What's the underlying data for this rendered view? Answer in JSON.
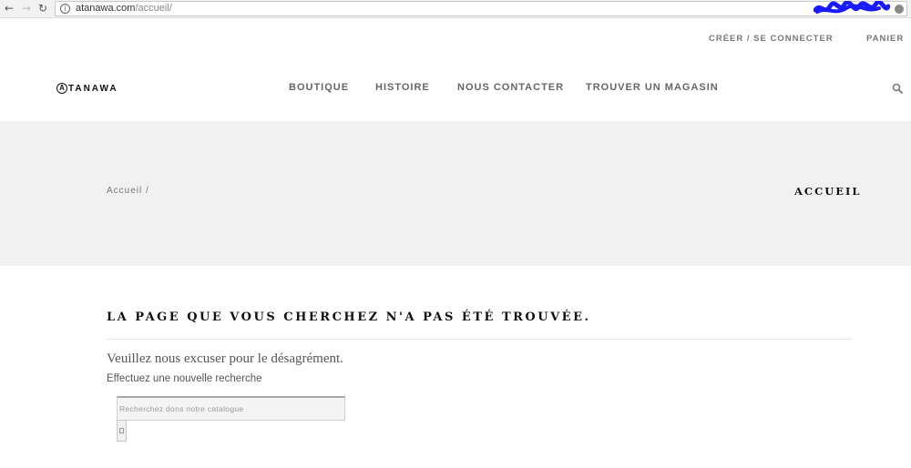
{
  "browser": {
    "url_host": "atanawa.com",
    "url_path": "/accueil/"
  },
  "top_links": {
    "login": "CRÉER / SE CONNECTER",
    "cart": "PANIER"
  },
  "logo": {
    "mark": "A",
    "text": "TANAWA"
  },
  "nav": {
    "items": [
      "BOUTIQUE",
      "HISTOIRE",
      "NOUS CONTACTER",
      "TROUVER UN MAGASIN"
    ]
  },
  "breadcrumb": {
    "home": "Accueil",
    "separator": " /"
  },
  "page_heading": "ACCUEIL",
  "error": {
    "title": "LA PAGE QUE VOUS CHERCHEZ N'A PAS ÉTÉ TROUVÉE.",
    "apology": "Veuillez nous excuser pour le désagrément.",
    "search_prompt": "Effectuez une nouvelle recherche"
  },
  "search": {
    "placeholder": "Recherchez dons notre catalogue"
  },
  "colors": {
    "hero_band": "#f1f1f1",
    "redaction": "#1a1aff"
  },
  "icons": [
    "back-arrow-icon",
    "forward-arrow-icon",
    "reload-icon",
    "info-icon",
    "profile-icon",
    "search-icon"
  ]
}
